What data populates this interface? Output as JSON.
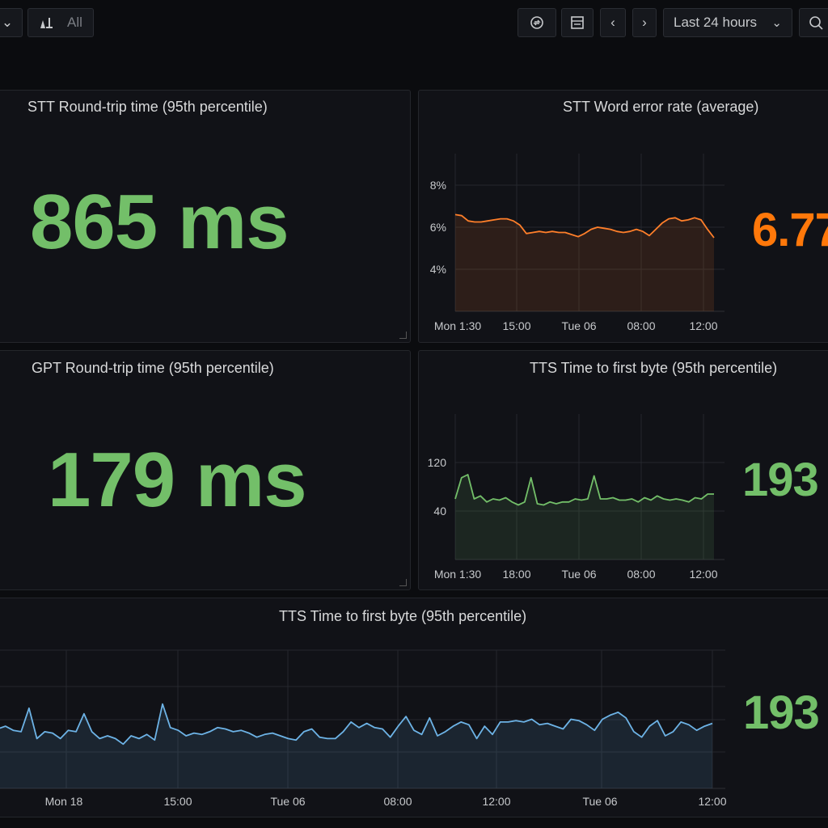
{
  "toolbar": {
    "filter_label": "All",
    "time_range": "Last 24 hours"
  },
  "panels": [
    {
      "id": "stt-rtt",
      "title": "STT Round-trip time (95th percentile)",
      "value": "865 ms",
      "value_color": "#73bf69"
    },
    {
      "id": "stt-wer",
      "title": "STT Word error rate (average)",
      "value": "6.77",
      "value_color": "#ff780a"
    },
    {
      "id": "gpt-rtt",
      "title": "GPT Round-trip time (95th percentile)",
      "value": "179 ms",
      "value_color": "#73bf69"
    },
    {
      "id": "tts-ttfb",
      "title": "TTS Time to first byte (95th percentile)",
      "value": "193",
      "value_color": "#73bf69"
    },
    {
      "id": "tts-ttfb-wide",
      "title": "TTS Time to first byte (95th percentile)",
      "value": "193",
      "value_color": "#73bf69"
    }
  ],
  "chart_data": [
    {
      "type": "area",
      "color": "#ff7f2a",
      "x_ticks": [
        "Mon 1:30",
        "15:00",
        "Tue 06",
        "08:00",
        "12:00"
      ],
      "y_ticks": [
        "8%",
        "6%",
        "4%"
      ],
      "y_tick_values": [
        8,
        6,
        4
      ],
      "ylim": [
        2.0,
        9.5
      ],
      "values": [
        6.6,
        6.55,
        6.3,
        6.25,
        6.25,
        6.3,
        6.35,
        6.4,
        6.4,
        6.3,
        6.1,
        5.7,
        5.75,
        5.8,
        5.75,
        5.8,
        5.75,
        5.75,
        5.65,
        5.55,
        5.7,
        5.9,
        6.0,
        5.95,
        5.9,
        5.8,
        5.75,
        5.8,
        5.9,
        5.8,
        5.6,
        5.9,
        6.2,
        6.4,
        6.45,
        6.3,
        6.35,
        6.45,
        6.35,
        5.9,
        5.5
      ]
    },
    {
      "type": "area",
      "color": "#73bf69",
      "x_ticks": [
        "Mon 1:30",
        "18:00",
        "Tue 06",
        "08:00",
        "12:00"
      ],
      "y_ticks": [
        "120",
        "40"
      ],
      "y_tick_values": [
        120,
        40
      ],
      "ylim": [
        -40,
        200
      ],
      "values": [
        60,
        95,
        100,
        60,
        65,
        55,
        60,
        58,
        62,
        55,
        50,
        55,
        95,
        52,
        50,
        55,
        52,
        55,
        55,
        60,
        58,
        60,
        98,
        60,
        60,
        62,
        58,
        58,
        60,
        55,
        62,
        58,
        65,
        60,
        58,
        60,
        58,
        55,
        62,
        60,
        68,
        68
      ]
    },
    {
      "type": "area",
      "color": "#6db3e6",
      "x_ticks": [
        "Mon 18",
        "15:00",
        "Tue 06",
        "08:00",
        "12:00",
        "Tue 06",
        "12:00"
      ],
      "ylim": [
        0,
        100
      ],
      "values": [
        43,
        45,
        42,
        41,
        58,
        36,
        41,
        40,
        36,
        42,
        41,
        54,
        41,
        36,
        38,
        36,
        32,
        38,
        36,
        39,
        35,
        61,
        44,
        42,
        38,
        40,
        39,
        41,
        44,
        43,
        41,
        42,
        40,
        37,
        39,
        40,
        38,
        36,
        35,
        41,
        43,
        37,
        36,
        36,
        41,
        48,
        44,
        47,
        44,
        43,
        37,
        45,
        52,
        42,
        39,
        51,
        38,
        41,
        45,
        48,
        46,
        36,
        45,
        39,
        48,
        48,
        49,
        48,
        50,
        46,
        47,
        45,
        43,
        50,
        49,
        46,
        42,
        50,
        53,
        55,
        51,
        41,
        37,
        45,
        49,
        38,
        41,
        48,
        46,
        42,
        45,
        47
      ]
    }
  ]
}
